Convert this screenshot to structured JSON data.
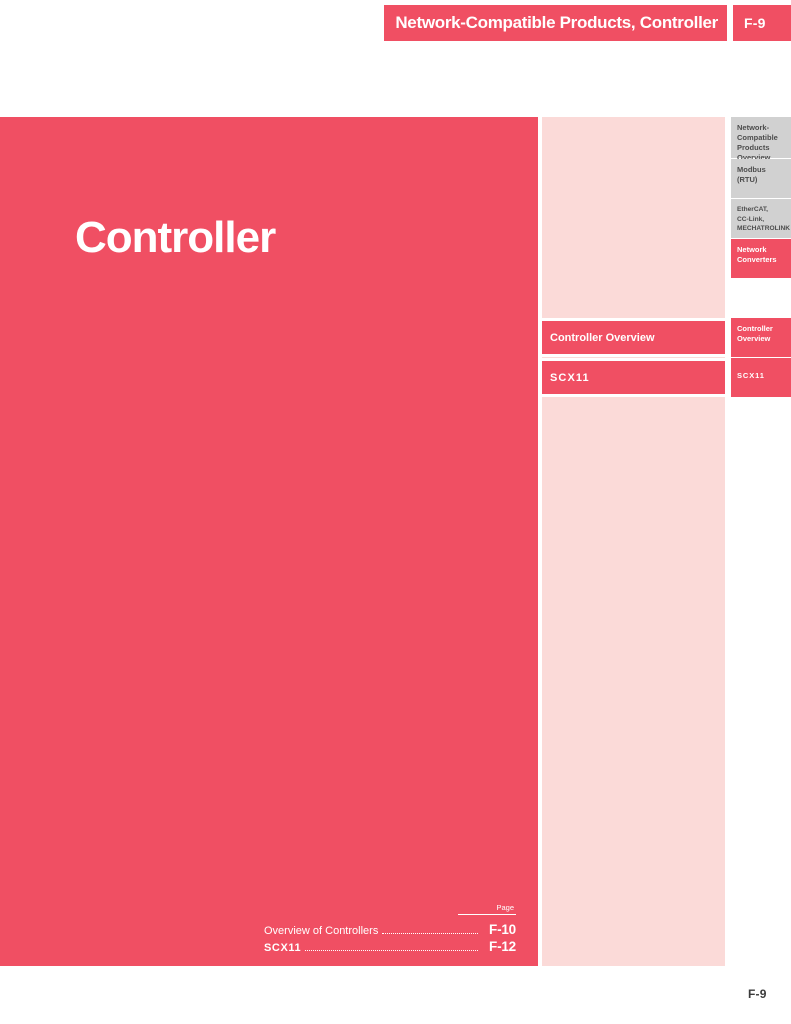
{
  "header": {
    "title": "Network-Compatible Products, Controller",
    "page_badge": "F-9",
    "bar_color": "#F04F63"
  },
  "cover": {
    "title": "Controller",
    "background_color": "#F04F63",
    "text_color": "#FFFFFF"
  },
  "toc": {
    "page_column_header": "Page",
    "entries": [
      {
        "label": "Overview of Controllers",
        "page": "F-10",
        "bold": false
      },
      {
        "label": "SCX11",
        "page": "F-12",
        "bold": true
      }
    ]
  },
  "mid_column": {
    "background_color": "#FBDAD8",
    "sections": [
      {
        "label": "Controller Overview"
      },
      {
        "label": "SCX11"
      }
    ]
  },
  "tab_rail": {
    "gray_color": "#D1D1D1",
    "active_color": "#F04F63",
    "tabs": [
      {
        "label": "Network-\nCompatible\nProducts\nOverview",
        "state": "inactive"
      },
      {
        "label": "Modbus\n(RTU)",
        "state": "inactive"
      },
      {
        "label": "EtherCAT,\nCC-Link,\nMECHATROLINK",
        "state": "inactive"
      },
      {
        "label": "Network\nConverters",
        "state": "active"
      },
      {
        "label": "Controller\nOverview",
        "state": "active"
      },
      {
        "label": "SCX11",
        "state": "active"
      }
    ]
  },
  "footer": {
    "page_number": "F-9"
  }
}
